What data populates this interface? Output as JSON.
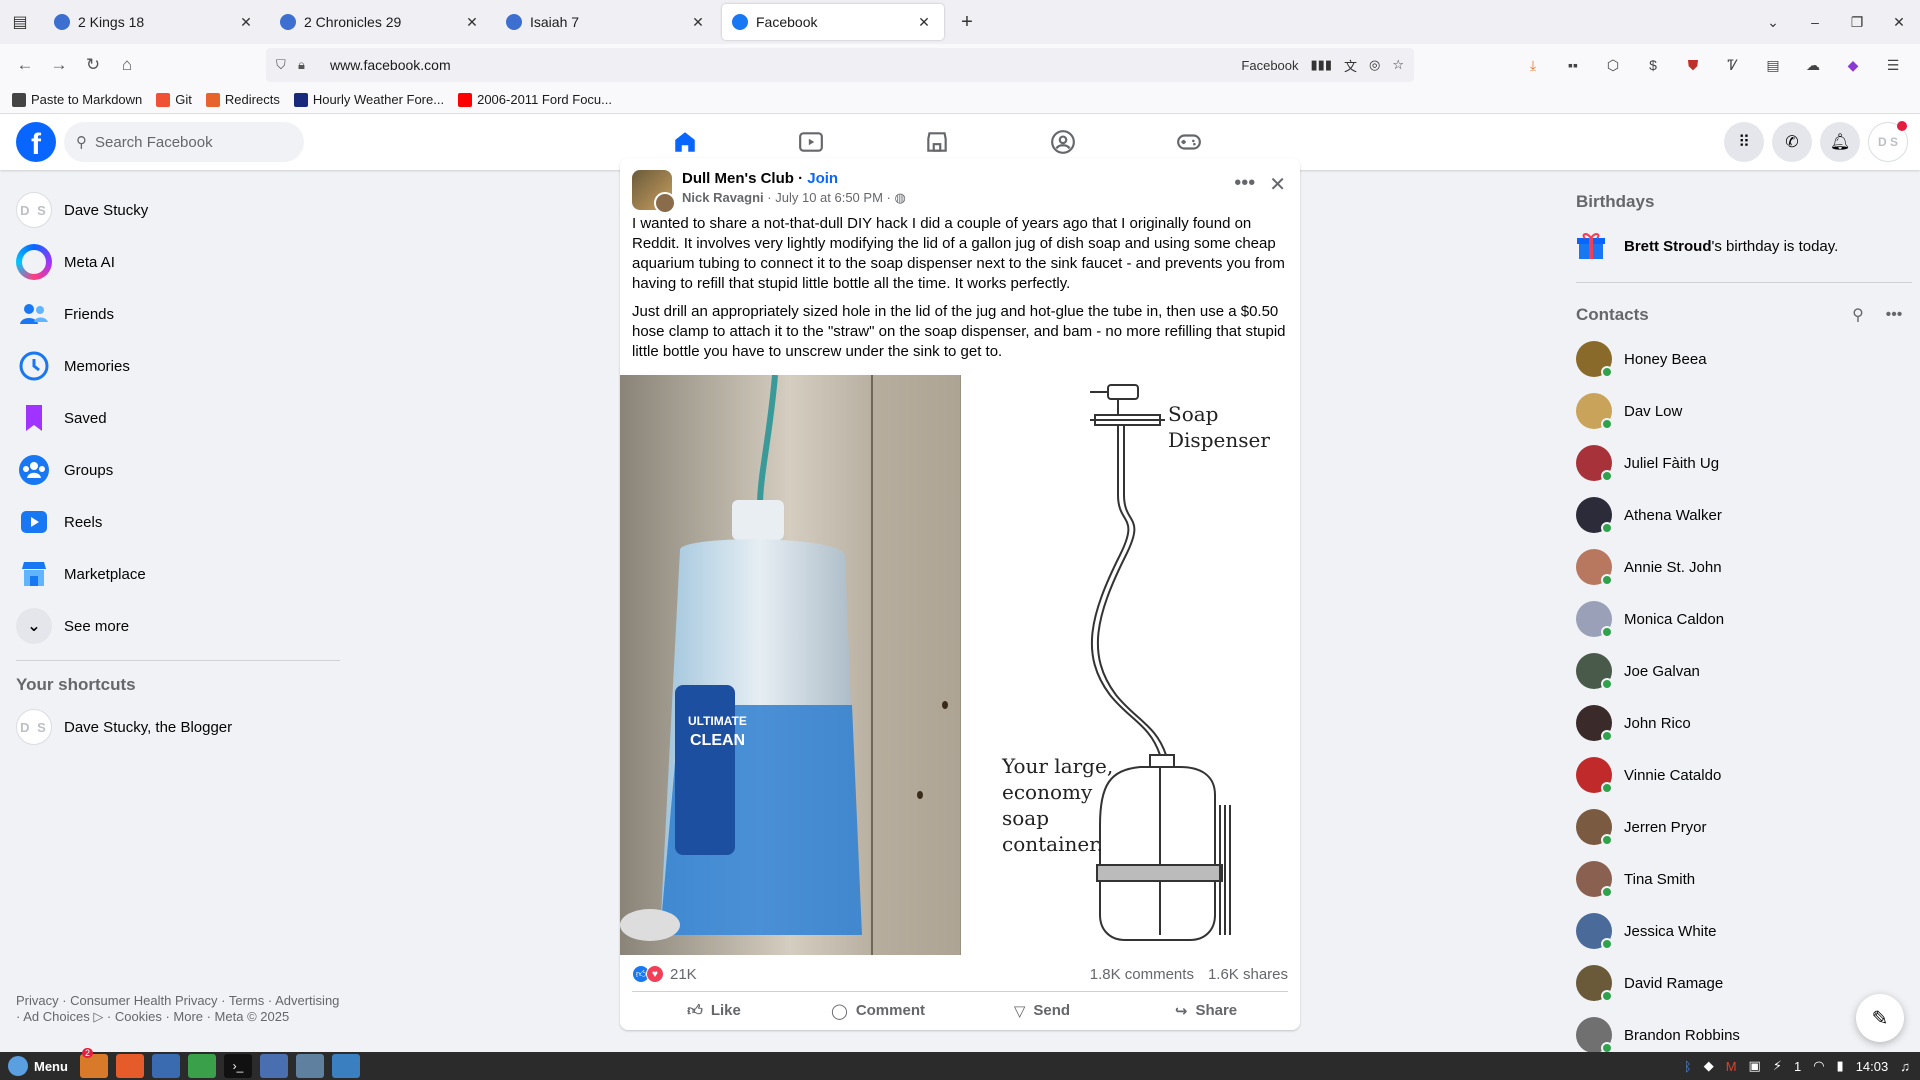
{
  "browser": {
    "tabs": [
      {
        "label": "2 Kings 18",
        "active": false
      },
      {
        "label": "2 Chronicles 29",
        "active": false
      },
      {
        "label": "Isaiah 7",
        "active": false
      },
      {
        "label": "Facebook",
        "active": true
      }
    ],
    "url": "www.facebook.com",
    "url_site_label": "Facebook",
    "bookmarks": [
      "Paste to Markdown",
      "Git",
      "Redirects",
      "Hourly Weather Fore...",
      "2006-2011 Ford Focu..."
    ]
  },
  "header": {
    "logo": "f",
    "search_placeholder": "Search Facebook",
    "avatar_initials": "D S"
  },
  "left_nav": {
    "items": [
      {
        "label": "Dave Stucky",
        "icon": "profile-avatar"
      },
      {
        "label": "Meta AI",
        "icon": "meta-ai-icon"
      },
      {
        "label": "Friends",
        "icon": "friends-icon"
      },
      {
        "label": "Memories",
        "icon": "memories-icon"
      },
      {
        "label": "Saved",
        "icon": "saved-icon"
      },
      {
        "label": "Groups",
        "icon": "groups-icon"
      },
      {
        "label": "Reels",
        "icon": "reels-icon"
      },
      {
        "label": "Marketplace",
        "icon": "marketplace-icon"
      },
      {
        "label": "See more",
        "icon": "chevron-down-icon"
      }
    ],
    "shortcuts_title": "Your shortcuts",
    "shortcuts": [
      {
        "label": "Dave Stucky, the Blogger"
      }
    ],
    "avatar_initials": "D S",
    "footer": "Privacy · Consumer Health Privacy · Terms · Advertising · Ad Choices ▷ · Cookies · More · Meta © 2025"
  },
  "post": {
    "group": "Dull Men's Club",
    "join": "Join",
    "author": "Nick Ravagni",
    "time": "July 10 at 6:50 PM",
    "paragraph1": "I wanted to share a not-that-dull DIY hack I did a couple of years ago that I originally found on Reddit. It involves very lightly modifying the lid of a gallon jug of dish soap and using some cheap aquarium tubing to connect it to the soap dispenser next to the sink faucet - and prevents you from having to refill that stupid little bottle all the time. It works perfectly.",
    "paragraph2": "Just drill an appropriately sized hole in the lid of the jug and hot-glue the tube in, then use a $0.50 hose clamp to attach it to the \"straw\" on the soap dispenser, and bam - no more refilling that stupid little bottle you have to unscrew under the sink to get to.",
    "diagram_label_top": "Soap Dispenser",
    "diagram_label_bottom": "Your large, economy soap container.",
    "reactions_count": "21K",
    "comments": "1.8K comments",
    "shares": "1.6K shares",
    "buttons": {
      "like": "Like",
      "comment": "Comment",
      "send": "Send",
      "share": "Share"
    }
  },
  "right": {
    "birthdays_title": "Birthdays",
    "birthday_name": "Brett Stroud",
    "birthday_rest": "'s birthday is today.",
    "contacts_title": "Contacts",
    "contacts": [
      {
        "name": "Honey Beea",
        "color": "#8a6a2a"
      },
      {
        "name": "Dav Low",
        "color": "#c9a35a"
      },
      {
        "name": "Juliel Fàith Ug",
        "color": "#a8323a"
      },
      {
        "name": "Athena Walker",
        "color": "#2b2b3a"
      },
      {
        "name": "Annie St. John",
        "color": "#b87860"
      },
      {
        "name": "Monica Caldon",
        "color": "#9aa0b8"
      },
      {
        "name": "Joe Galvan",
        "color": "#4a5a4a"
      },
      {
        "name": "John Rico",
        "color": "#3a2a2a"
      },
      {
        "name": "Vinnie Cataldo",
        "color": "#c02a2a"
      },
      {
        "name": "Jerren Pryor",
        "color": "#7a5a40"
      },
      {
        "name": "Tina Smith",
        "color": "#8a6050"
      },
      {
        "name": "Jessica White",
        "color": "#4a6a9a"
      },
      {
        "name": "David Ramage",
        "color": "#6a5a3a"
      },
      {
        "name": "Brandon Robbins",
        "color": "#707070"
      }
    ]
  },
  "taskbar": {
    "menu_label": "Menu",
    "badge": "2",
    "clock": "14:03",
    "network_count": "1"
  }
}
